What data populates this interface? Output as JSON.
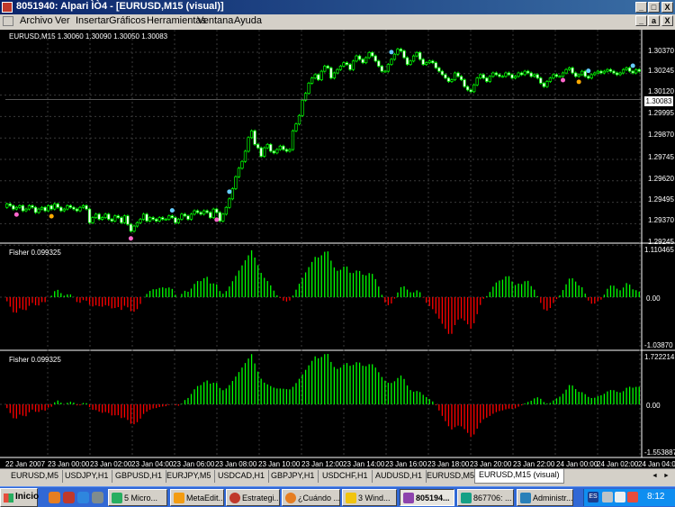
{
  "window": {
    "title": "8051940: Alpari ÌÒ4 - [EURUSD,M15 (visual)]",
    "buttons": [
      "_",
      "□",
      "X"
    ]
  },
  "menubar": {
    "items": [
      "Archivo",
      "Ver",
      "Insertar",
      "Gráficos",
      "Herramientas",
      "Ventana",
      "Ayuda"
    ],
    "mdi_buttons": [
      "_",
      "a",
      "X"
    ]
  },
  "chart": {
    "symbol_info": "EURUSD,M15  1.30060 1.30090 1.30050 1.30083",
    "current_price": "1.30083",
    "price_ticks": [
      "1.30370",
      "1.30245",
      "1.30120",
      "1.29995",
      "1.29870",
      "1.29745",
      "1.29620",
      "1.29495",
      "1.29370",
      "1.29245"
    ],
    "indicator1": {
      "label": "Fisher 0.099325",
      "ticks": [
        "1.110465",
        "0.00",
        "-1.03870"
      ]
    },
    "indicator2": {
      "label": "Fisher 0.099325",
      "ticks": [
        "1.722214",
        "0.00",
        "-1.553887"
      ]
    },
    "time_ticks": [
      "22 Jan 2007",
      "23 Jan 00:00",
      "23 Jan 02:00",
      "23 Jan 04:00",
      "23 Jan 06:00",
      "23 Jan 08:00",
      "23 Jan 10:00",
      "23 Jan 12:00",
      "23 Jan 14:00",
      "23 Jan 16:00",
      "23 Jan 18:00",
      "23 Jan 20:00",
      "23 Jan 22:00",
      "24 Jan 00:00",
      "24 Jan 02:00",
      "24 Jan 04:00"
    ],
    "colors": {
      "background": "#000000",
      "bull": "#00ff00",
      "bear": "#ff0000",
      "grid": "#3a3a3a"
    }
  },
  "chart_data": {
    "type": "line",
    "ylim": [
      1.29245,
      1.3042
    ],
    "close": [
      1.2947,
      1.2946,
      1.2944,
      1.2945,
      1.2946,
      1.2943,
      1.2944,
      1.2946,
      1.2945,
      1.2942,
      1.2944,
      1.2945,
      1.2943,
      1.2946,
      1.2944,
      1.2947,
      1.2945,
      1.2943,
      1.2944,
      1.2946,
      1.2945,
      1.2944,
      1.2943,
      1.2945,
      1.2946,
      1.2944,
      1.2936,
      1.2939,
      1.2941,
      1.2938,
      1.2939,
      1.2941,
      1.2938,
      1.2937,
      1.294,
      1.2939,
      1.2936,
      1.294,
      1.2935,
      1.2931,
      1.2934,
      1.2936,
      1.2938,
      1.2941,
      1.2937,
      1.2939,
      1.2938,
      1.2937,
      1.2939,
      1.2938,
      1.2938,
      1.294,
      1.2939,
      1.2936,
      1.2938,
      1.2941,
      1.294,
      1.2938,
      1.2941,
      1.2943,
      1.2942,
      1.2941,
      1.2943,
      1.2942,
      1.2939,
      1.2944,
      1.2942,
      1.2937,
      1.2941,
      1.2945,
      1.295,
      1.2956,
      1.2963,
      1.2968,
      1.2972,
      1.2978,
      1.2986,
      1.299,
      1.2982,
      1.298,
      1.2975,
      1.298,
      1.2982,
      1.2978,
      1.2977,
      1.2979,
      1.2981,
      1.2979,
      1.2978,
      1.2979,
      1.299,
      1.2994,
      1.2999,
      1.3008,
      1.3012,
      1.3018,
      1.3021,
      1.3023,
      1.302,
      1.3025,
      1.3028,
      1.3027,
      1.3021,
      1.3024,
      1.3026,
      1.3028,
      1.303,
      1.3029,
      1.3026,
      1.3031,
      1.3034,
      1.3032,
      1.303,
      1.3033,
      1.3036,
      1.3034,
      1.3031,
      1.3028,
      1.3025,
      1.3025,
      1.3029,
      1.3032,
      1.3035,
      1.3038,
      1.3037,
      1.3033,
      1.3029,
      1.3031,
      1.3034,
      1.3036,
      1.3032,
      1.3029,
      1.303,
      1.3031,
      1.303,
      1.3027,
      1.3025,
      1.3023,
      1.3021,
      1.3019,
      1.302,
      1.3024,
      1.3022,
      1.302,
      1.3016,
      1.3014,
      1.3013,
      1.3017,
      1.3021,
      1.3023,
      1.3021,
      1.3019,
      1.3022,
      1.3024,
      1.3023,
      1.3022,
      1.3022,
      1.3024,
      1.3023,
      1.3021,
      1.3022,
      1.3024,
      1.3023,
      1.3025,
      1.3024,
      1.3022,
      1.3023,
      1.3021,
      1.3018,
      1.3016,
      1.3019,
      1.3021,
      1.3023,
      1.3022,
      1.3022,
      1.3024,
      1.3026,
      1.3027,
      1.3024,
      1.3022,
      1.3023,
      1.3025,
      1.3022,
      1.3021,
      1.3023,
      1.3024,
      1.3025,
      1.3024,
      1.3025,
      1.3026,
      1.3025,
      1.3024,
      1.3023,
      1.3024,
      1.3026,
      1.3027,
      1.3025,
      1.3024,
      1.3026,
      1.3025
    ]
  },
  "tabs": {
    "items": [
      "EURUSD,M5",
      "USDJPY,H1",
      "GBPUSD,H1",
      "EURJPY,M5",
      "USDCAD,H1",
      "GBPJPY,H1",
      "USDCHF,H1",
      "AUDUSD,H1",
      "EURUSD,M5",
      "EURUSD,M15 (visual)"
    ],
    "nav": [
      "◄",
      "►"
    ]
  },
  "taskbar": {
    "start_label": "Inicio",
    "buttons": [
      "5 Micro...",
      "MetaEdit...",
      "Estrategi...",
      "¿Cuándo ...",
      "3 Wind...",
      "805194...",
      "867706: ...",
      "Administr..."
    ],
    "active_index": 5,
    "tray_lang": "ES",
    "clock": "8:12"
  }
}
